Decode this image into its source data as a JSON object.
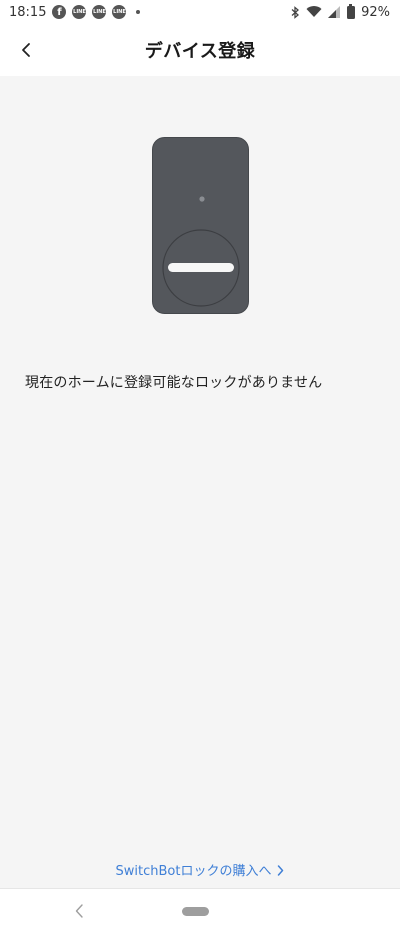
{
  "status_bar": {
    "time": "18:15",
    "notification_icons": [
      "facebook-icon",
      "line-icon",
      "line-icon",
      "line-icon"
    ],
    "line_label": "LINE",
    "battery": "92%"
  },
  "header": {
    "title": "デバイス登録"
  },
  "main": {
    "message": "現在のホームに登録可能なロックがありません",
    "purchase_link": "SwitchBotロックの購入へ"
  },
  "colors": {
    "device_body": "#54575c",
    "link": "#3f7fd6",
    "background": "#f5f5f5"
  }
}
